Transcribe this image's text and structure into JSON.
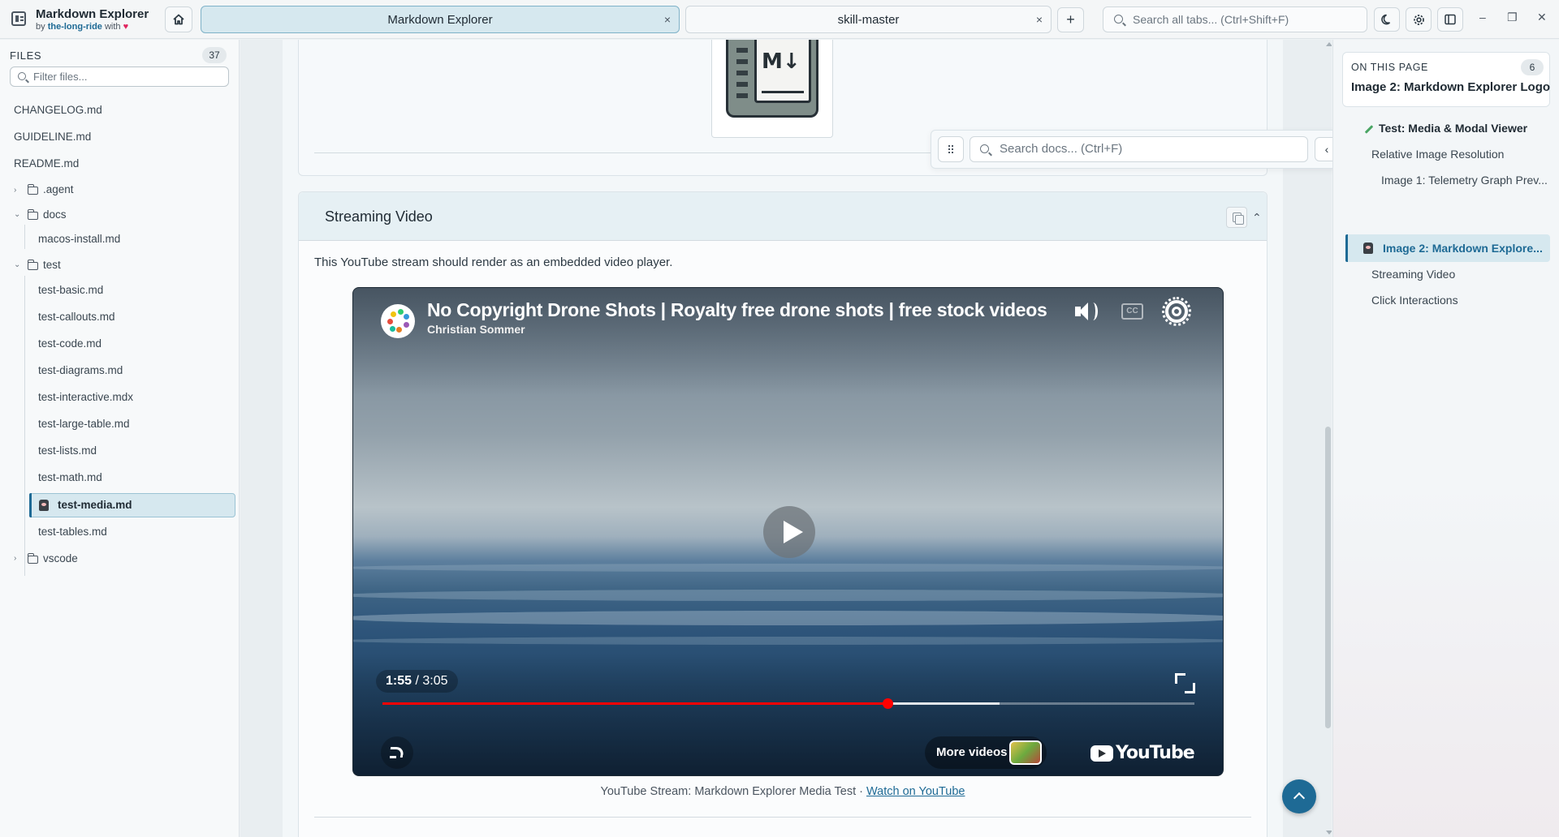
{
  "app": {
    "name": "Markdown Explorer",
    "by_prefix": "by",
    "author": "the-long-ride",
    "with_text": "with",
    "heart": "♥"
  },
  "tabs": [
    {
      "label": "Markdown Explorer",
      "active": true,
      "close": "×"
    },
    {
      "label": "skill-master",
      "active": false,
      "close": "×"
    }
  ],
  "toolbar": {
    "new_tab": "+",
    "search_placeholder": "Search all tabs... (Ctrl+Shift+F)",
    "theme_icon": "moon-icon",
    "settings_icon": "gear-icon",
    "layout_icon": "sidebar-toggle-icon",
    "minimize": "–",
    "restore": "❐",
    "close": "✕"
  },
  "sidebar": {
    "files_label": "FILES",
    "file_count": "37",
    "filter_placeholder": "Filter files...",
    "root_files": [
      "CHANGELOG.md",
      "GUIDELINE.md",
      "README.md"
    ],
    "folder_agent": ".agent",
    "folder_docs": "docs",
    "docs_files": [
      "macos-install.md"
    ],
    "folder_test": "test",
    "test_files": [
      "test-basic.md",
      "test-callouts.md",
      "test-code.md",
      "test-diagrams.md",
      "test-interactive.mdx",
      "test-large-table.md",
      "test-lists.md",
      "test-math.md",
      "test-media.md",
      "test-tables.md"
    ],
    "folder_vscode": "vscode",
    "active_file": "test-media.md"
  },
  "doc_search": {
    "placeholder": "Search docs... (Ctrl+F)",
    "close_label": "‹"
  },
  "content": {
    "logo_text": "M↓",
    "section_title": "Streaming Video",
    "collapse_label": "⌃",
    "section_desc": "This YouTube stream should render as an embedded video player.",
    "caption_text": "YouTube Stream: Markdown Explorer Media Test · ",
    "caption_link": "Watch on YouTube"
  },
  "video": {
    "title": "No Copyright Drone Shots | Royalty free drone shots | free stock videos | Drone footage",
    "channel": "Christian Sommer",
    "current_time": "1:55",
    "separator": " / ",
    "duration": "3:05",
    "progress_fraction": 0.622,
    "buffered_fraction": 0.76,
    "cc_label": "CC",
    "more_videos": "More videos",
    "youtube_wordmark": "YouTube",
    "progress_color": "#ff0000"
  },
  "toc": {
    "label": "ON THIS PAGE",
    "count": "6",
    "current": "Image 2: Markdown Explorer Logo",
    "items": [
      "Test: Media & Modal Viewer",
      "Relative Image Resolution",
      "Image 1: Telemetry Graph Prev...",
      "Image 2: Markdown Explore...",
      "Streaming Video",
      "Click Interactions"
    ]
  },
  "colors": {
    "accent": "#1e6a95",
    "active_bg": "#d6e8ef",
    "heart": "#e0245e"
  }
}
